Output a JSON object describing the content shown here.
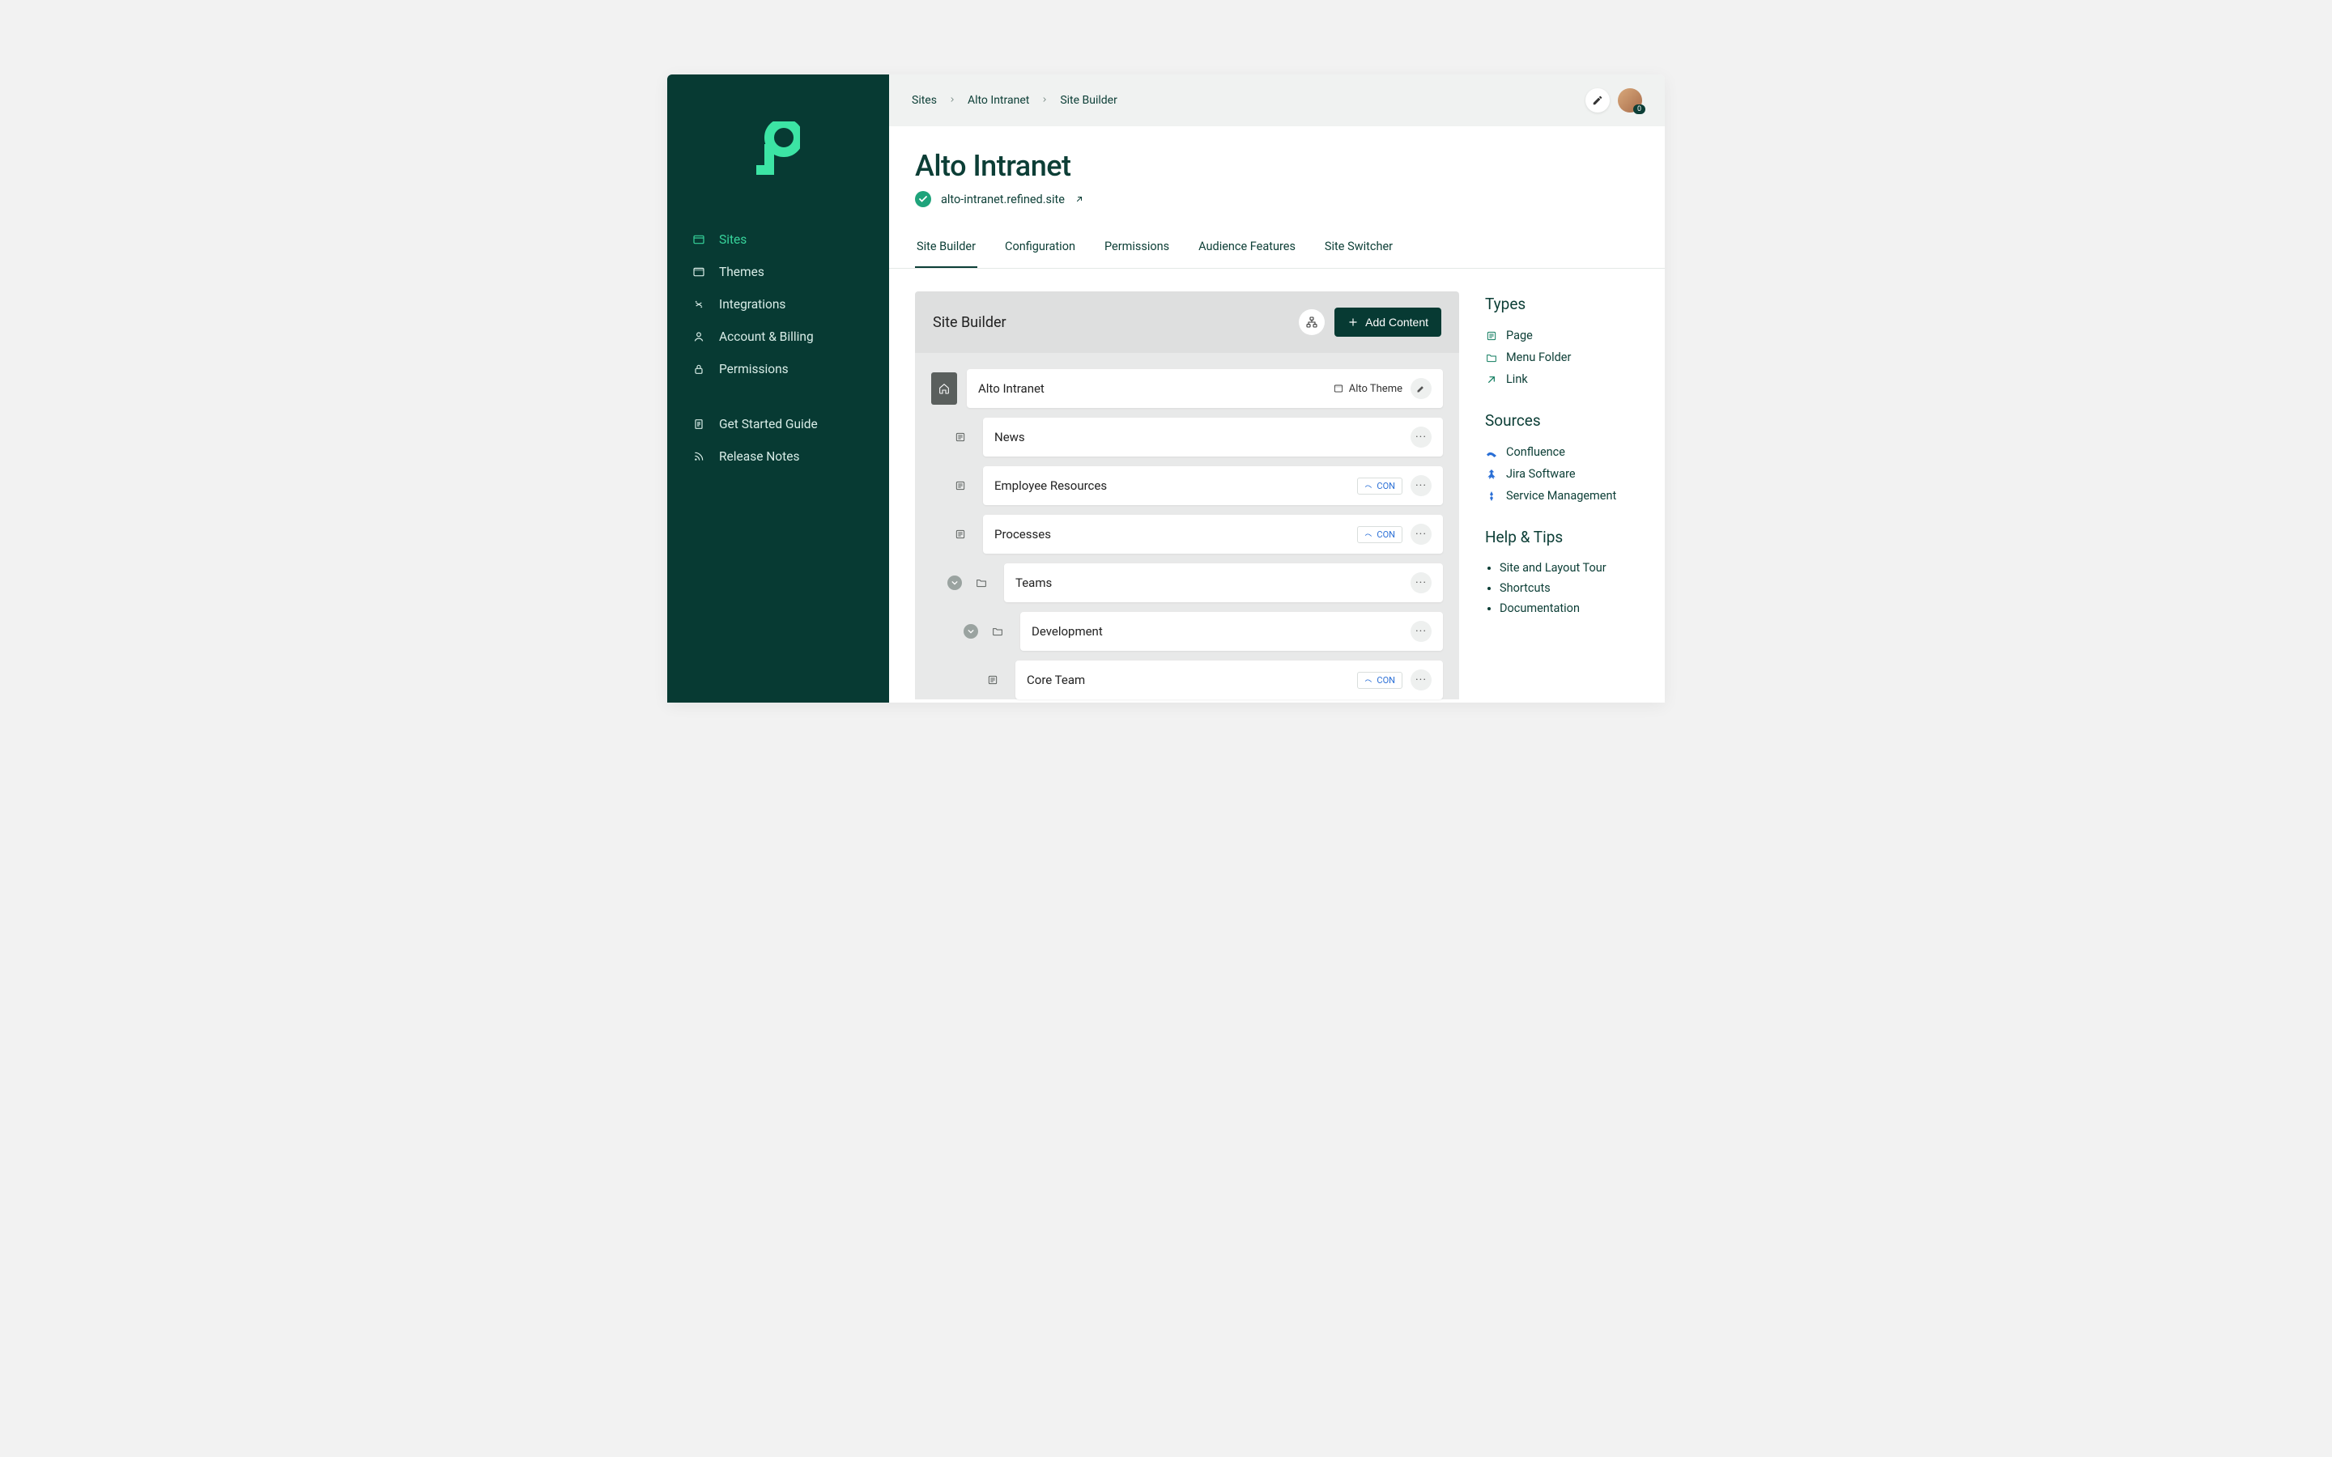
{
  "breadcrumbs": [
    "Sites",
    "Alto Intranet",
    "Site Builder"
  ],
  "avatar_badge": "0",
  "page": {
    "title": "Alto Intranet",
    "url": "alto-intranet.refined.site"
  },
  "tabs": [
    "Site Builder",
    "Configuration",
    "Permissions",
    "Audience Features",
    "Site Switcher"
  ],
  "builder": {
    "header": "Site Builder",
    "add_button": "Add Content",
    "root": {
      "label": "Alto Intranet",
      "theme": "Alto Theme"
    },
    "items": [
      {
        "label": "News",
        "depth": 1,
        "icon": "page",
        "badge": "",
        "more": true
      },
      {
        "label": "Employee Resources",
        "depth": 1,
        "icon": "page",
        "badge": "CON",
        "more": true
      },
      {
        "label": "Processes",
        "depth": 1,
        "icon": "page",
        "badge": "CON",
        "more": true
      },
      {
        "label": "Teams",
        "depth": 1,
        "icon": "folder",
        "badge": "",
        "more": true,
        "chev": true
      },
      {
        "label": "Development",
        "depth": 2,
        "icon": "folder",
        "badge": "",
        "more": true,
        "chev": true
      },
      {
        "label": "Core Team",
        "depth": 3,
        "icon": "page",
        "badge": "CON",
        "more": true
      }
    ]
  },
  "sidebar_nav": [
    {
      "label": "Sites",
      "icon": "sites",
      "active": true
    },
    {
      "label": "Themes",
      "icon": "themes"
    },
    {
      "label": "Integrations",
      "icon": "integrations"
    },
    {
      "label": "Account & Billing",
      "icon": "account"
    },
    {
      "label": "Permissions",
      "icon": "permissions"
    }
  ],
  "sidebar_secondary": [
    {
      "label": "Get Started Guide",
      "icon": "doc"
    },
    {
      "label": "Release Notes",
      "icon": "rss"
    }
  ],
  "panel": {
    "types_head": "Types",
    "types": [
      {
        "label": "Page",
        "icon": "page"
      },
      {
        "label": "Menu Folder",
        "icon": "folder"
      },
      {
        "label": "Link",
        "icon": "link"
      }
    ],
    "sources_head": "Sources",
    "sources": [
      {
        "label": "Confluence",
        "icon": "confluence"
      },
      {
        "label": "Jira Software",
        "icon": "jira"
      },
      {
        "label": "Service Management",
        "icon": "jsm"
      }
    ],
    "help_head": "Help & Tips",
    "help": [
      "Site and Layout Tour",
      "Shortcuts",
      "Documentation"
    ]
  }
}
